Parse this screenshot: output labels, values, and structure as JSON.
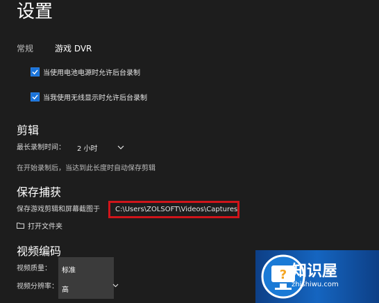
{
  "page": {
    "title": "设置"
  },
  "tabs": [
    {
      "label": "常规"
    },
    {
      "label": "游戏 DVR"
    }
  ],
  "options": {
    "battery_record": {
      "label": "当使用电池电源时允许后台录制",
      "checked": true
    },
    "wireless_record": {
      "label": "当我使用无线显示时允许后台录制",
      "checked": true
    }
  },
  "clip": {
    "heading": "剪辑",
    "max_time_label": "最长录制时间：",
    "max_time_value": "2 小时",
    "note": "在开始录制后，当达到此长度时自动保存剪辑"
  },
  "captures": {
    "heading": "保存捕获",
    "save_label": "保存游戏剪辑和屏幕截图于",
    "path": "C:\\Users\\ZOLSOFT\\Videos\\Captures",
    "open_folder": "打开文件夹"
  },
  "encoding": {
    "heading": "视频编码",
    "quality_label": "视频质量：",
    "resolution_label": "视频分辨率：",
    "options": [
      "标准",
      "高"
    ]
  },
  "watermark": {
    "name": "知识屋",
    "url": "zhishiwu.com"
  },
  "colors": {
    "accent": "#1a73d9",
    "highlight_box": "#d0141a",
    "background": "#1d1d1d"
  }
}
